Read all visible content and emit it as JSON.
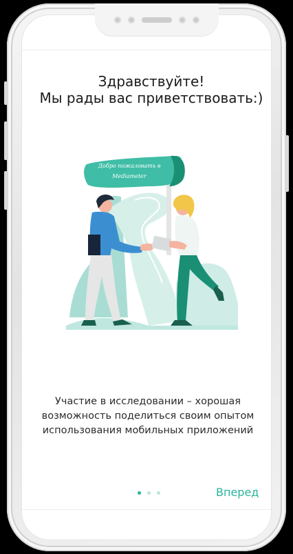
{
  "welcome": {
    "title_line1": "Здравствуйте!",
    "title_line2": "Мы рады вас приветствовать:)",
    "sign_line1": "Добро пожаловать в",
    "sign_line2": "Mediameter",
    "description_line1": "Участие в исследовании – хорошая",
    "description_line2": "возможность поделиться своим опытом",
    "description_line3": "использования мобильных приложений"
  },
  "pager": {
    "total": 3,
    "active": 1
  },
  "actions": {
    "next_label": "Вперед"
  },
  "colors": {
    "accent": "#2ab39c",
    "teal_light": "#a9ddd3",
    "teal_dark": "#1a8f74",
    "shirt_blue": "#3b8fd1",
    "hair_yellow": "#f2c649"
  },
  "icons": [
    "welcome-illustration"
  ]
}
